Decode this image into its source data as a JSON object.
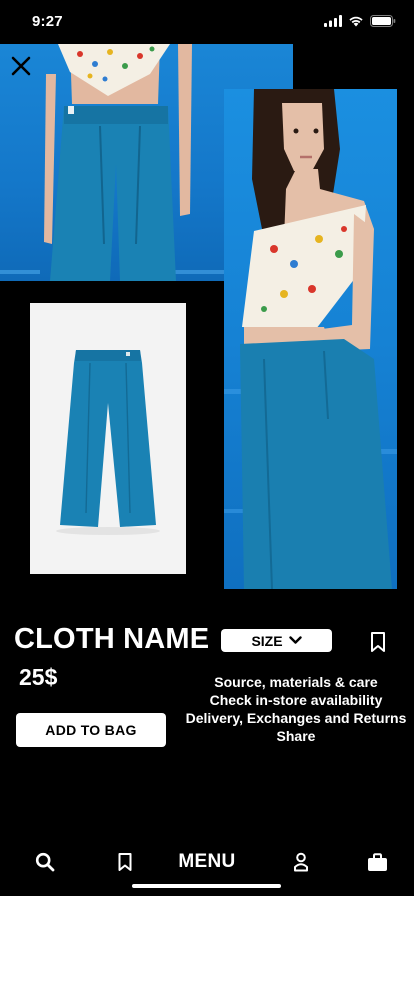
{
  "status_bar": {
    "time": "9:27",
    "icons": [
      "signal-icon",
      "wifi-icon",
      "battery-icon"
    ]
  },
  "gallery": {
    "images": [
      {
        "name": "model-lower-body-photo",
        "description_icon": "photo"
      },
      {
        "name": "model-side-photo",
        "description_icon": "photo"
      },
      {
        "name": "product-flat-photo",
        "description_icon": "photo"
      }
    ],
    "colors": {
      "backdrop_blue": "#1682d4",
      "pants_teal": "#1a7fb0",
      "product_bg": "#f3f3f3"
    }
  },
  "product": {
    "name": "CLOTH NAME",
    "price": "25$",
    "size_label": "SIZE",
    "add_to_bag_label": "ADD TO BAG",
    "info_links": [
      "Source, materials & care",
      "Check in-store availability",
      "Delivery, Exchanges and Returns",
      "Share"
    ]
  },
  "bottom_nav": {
    "menu_label": "MENU",
    "icons": [
      "search-icon",
      "bookmark-icon",
      "user-icon",
      "bag-icon"
    ]
  },
  "theme": {
    "background": "#000000",
    "foreground": "#ffffff"
  }
}
